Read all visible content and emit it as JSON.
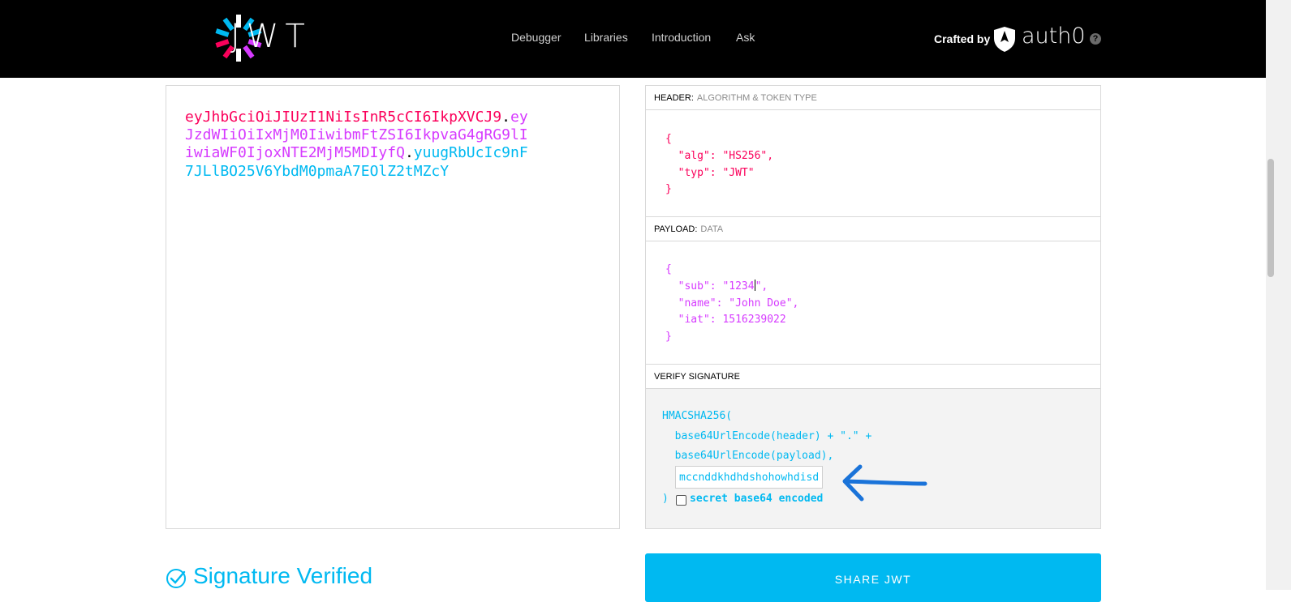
{
  "nav": {
    "logo_text": "JWT",
    "items": [
      "Debugger",
      "Libraries",
      "Introduction",
      "Ask"
    ],
    "crafted_by": "Crafted by",
    "brand": "auth0",
    "help": "?"
  },
  "encoded": {
    "line1_header": "eyJhbGciOiJIUzI1NiIsInR5cCI6IkpXVCJ9",
    "line1_dot": ".",
    "line1_payload": "ey",
    "line2_payload": "JzdWIiOiIxMjM0IiwibmFtZSI6IkpvaG4gRG9lI",
    "line3_payload": "iwiaWF0IjoxNTE2MjM5MDIyfQ",
    "line3_dot": ".",
    "line3_sig": "yuugRbUcIc9nF",
    "line4_sig": "7JLlBO25V6YbdM0pmaA7EOlZ2tMZcY"
  },
  "header_section": {
    "title": "HEADER:",
    "subtitle": "ALGORITHM & TOKEN TYPE",
    "open": "{",
    "line_alg": "  \"alg\": \"HS256\",",
    "line_typ": "  \"typ\": \"JWT\"",
    "close": "}"
  },
  "payload_section": {
    "title": "PAYLOAD:",
    "subtitle": "DATA",
    "open": "{",
    "line_sub_a": "  \"sub\": \"1234",
    "line_sub_b": "\",",
    "line_name": "  \"name\": \"John Doe\",",
    "line_iat": "  \"iat\": 1516239022",
    "close": "}"
  },
  "verify_section": {
    "title": "VERIFY SIGNATURE",
    "line1": "HMACSHA256(",
    "line2": "  base64UrlEncode(header) + \".\" +",
    "line3": "  base64UrlEncode(payload),",
    "secret_value": "mccnddkhdhdshohowhdisd",
    "close_paren": ")",
    "checkbox_label": "secret base64 encoded"
  },
  "bottom": {
    "verified_text": "Signature Verified",
    "share_button": "SHARE JWT"
  },
  "colors": {
    "header": "#fb015b",
    "payload": "#d63aff",
    "signature": "#00b9f1",
    "arrow": "#1a73d9"
  }
}
